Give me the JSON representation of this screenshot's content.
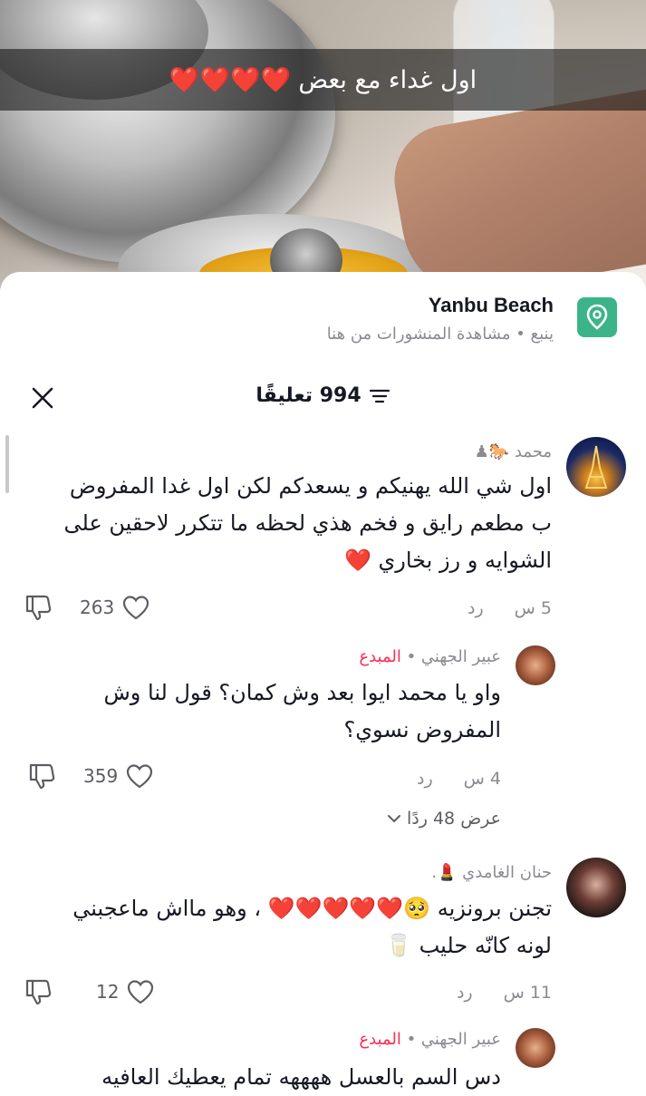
{
  "video": {
    "caption": "اول غداء مع بعض",
    "caption_hearts": "❤️❤️❤️❤️"
  },
  "location": {
    "title": "Yanbu Beach",
    "subtitle": "ينبع • مشاهدة المنشورات من هنا",
    "icon": "location-pin-icon"
  },
  "comments_header": {
    "count_label": "994 تعليقًا",
    "sort_icon": "filter-lines-icon",
    "close_icon": "close-icon"
  },
  "comments": [
    {
      "username": "محمد 🐎♟",
      "is_creator": false,
      "text": "اول شي الله يهنيكم و يسعدكم لكن اول غدا المفروض ب مطعم رايق و فخم هذي لحظه ما تتكرر لاحقين على الشوايه و رز بخاري",
      "emoji": "❤️",
      "time": "5 س",
      "reply_label": "رد",
      "likes": "263"
    },
    {
      "username": "عبير الجهني",
      "creator_label": "المبدع",
      "is_creator": true,
      "text": "واو يا محمد ايوا بعد وش كمان؟ قول لنا وش المفروض نسوي؟",
      "time": "4 س",
      "reply_label": "رد",
      "likes": "359",
      "view_replies": "عرض 48 ردًا"
    },
    {
      "username": "حنان الغامدي 💄.",
      "is_creator": false,
      "text_part1": "تجنن برونزيه 🥺❤️❤️❤️❤️❤️ ، وهو مااش ماعجبني",
      "text_part2": "لونه كانّه حليب 🥛",
      "time": "11 س",
      "reply_label": "رد",
      "likes": "12"
    },
    {
      "username": "عبير الجهني",
      "creator_label": "المبدع",
      "is_creator": true,
      "text": "دس السم بالعسل ههههه تمام يعطيك العافيه"
    }
  ]
}
